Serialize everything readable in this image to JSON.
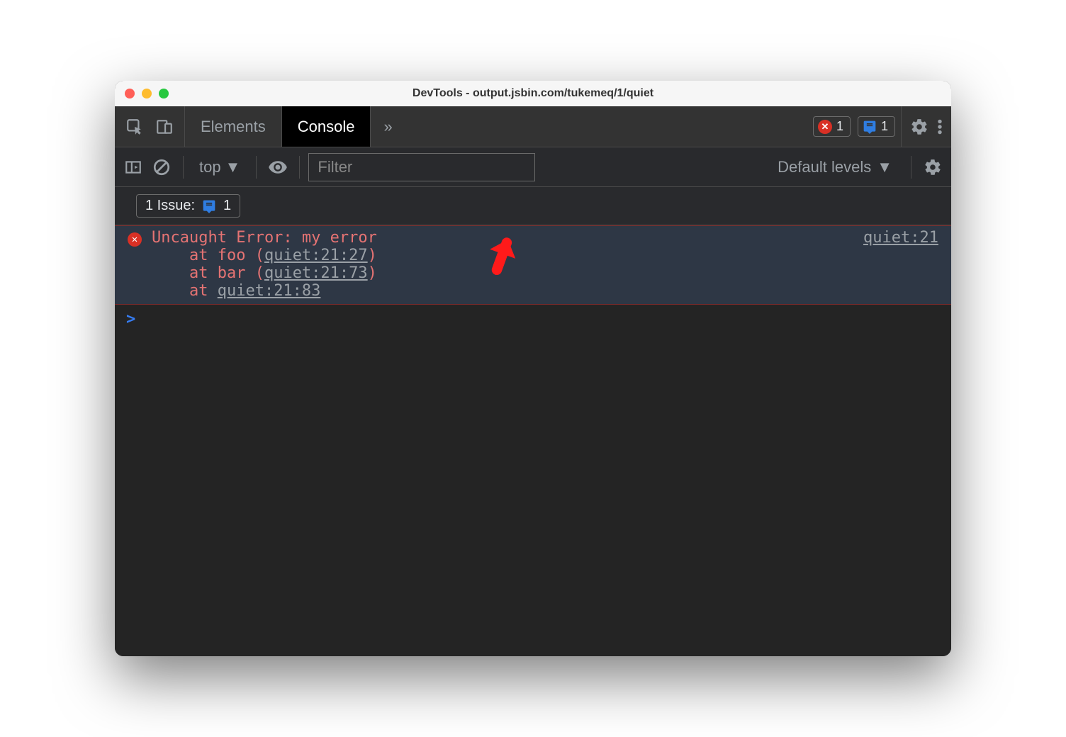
{
  "window": {
    "title": "DevTools - output.jsbin.com/tukemeq/1/quiet"
  },
  "tabs": {
    "elements": "Elements",
    "console": "Console",
    "more": "»"
  },
  "badges": {
    "error_count": "1",
    "issue_count": "1"
  },
  "toolbar": {
    "context": "top",
    "filter_placeholder": "Filter",
    "levels": "Default levels"
  },
  "issues": {
    "label": "1 Issue:",
    "count": "1"
  },
  "error": {
    "message": "Uncaught Error: my error",
    "source_link": "quiet:21",
    "stack": [
      {
        "prefix": "    at foo (",
        "link": "quiet:21:27",
        "suffix": ")"
      },
      {
        "prefix": "    at bar (",
        "link": "quiet:21:73",
        "suffix": ")"
      },
      {
        "prefix": "    at ",
        "link": "quiet:21:83",
        "suffix": ""
      }
    ]
  },
  "prompt": ">"
}
